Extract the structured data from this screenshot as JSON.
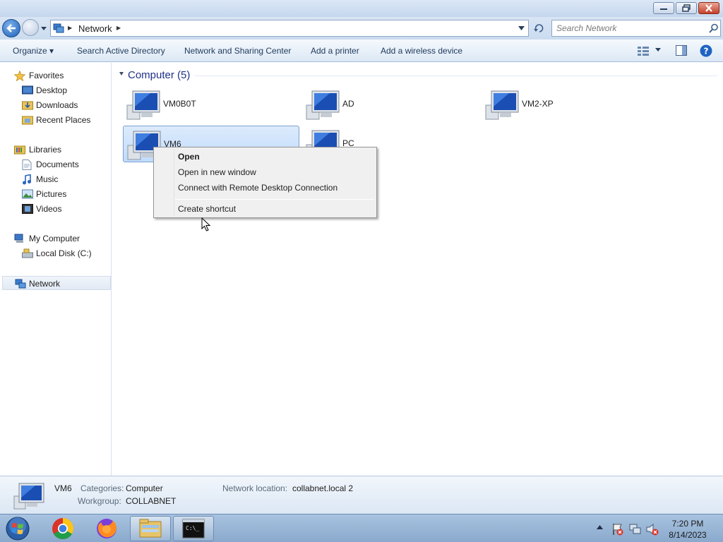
{
  "window": {
    "title": ""
  },
  "address": {
    "crumb": "Network"
  },
  "search": {
    "placeholder": "Search Network"
  },
  "toolbar": {
    "organize_label": "Organize ▾",
    "search_ad_label": "Search Active Directory",
    "netshare_label": "Network and Sharing Center",
    "printer_label": "Add a printer",
    "wireless_label": "Add a wireless device"
  },
  "sidebar": {
    "favorites": {
      "label": "Favorites",
      "items": [
        "Desktop",
        "Downloads",
        "Recent Places"
      ]
    },
    "libraries": {
      "label": "Libraries",
      "items": [
        "Documents",
        "Music",
        "Pictures",
        "Videos"
      ]
    },
    "computer": {
      "label": "My Computer",
      "items": [
        "Local Disk (C:)"
      ]
    },
    "network": {
      "label": "Network"
    }
  },
  "content": {
    "group_header": "Computer (5)",
    "items": [
      {
        "name": "VM0B0T",
        "icon": "computer-icon"
      },
      {
        "name": "AD",
        "icon": "computer-icon"
      },
      {
        "name": "VM2-XP",
        "icon": "computer-icon"
      },
      {
        "name": "VM6",
        "icon": "computer-icon",
        "selected": true
      },
      {
        "name": "PC",
        "icon": "computer-icon"
      }
    ]
  },
  "context_menu": {
    "items": [
      "Open",
      "Open in new window",
      "Connect with Remote Desktop Connection",
      "Create shortcut"
    ]
  },
  "details": {
    "name": "VM6",
    "categories_label": "Categories:",
    "categories_value": "Computer",
    "workgroup_label": "Workgroup:",
    "workgroup_value": "COLLABNET",
    "location_label": "Network location:",
    "location_value": "collabnet.local  2"
  },
  "taskbar": {
    "apps": [
      "start-orb",
      "chrome-icon",
      "firefox-icon",
      "explorer-icon",
      "cmd-icon"
    ],
    "time": "7:20 PM",
    "date": "8/14/2023"
  },
  "colors": {
    "accent": "#1e3287",
    "selection": "#c1dbfc",
    "taskbar": "#8aa9cc"
  }
}
